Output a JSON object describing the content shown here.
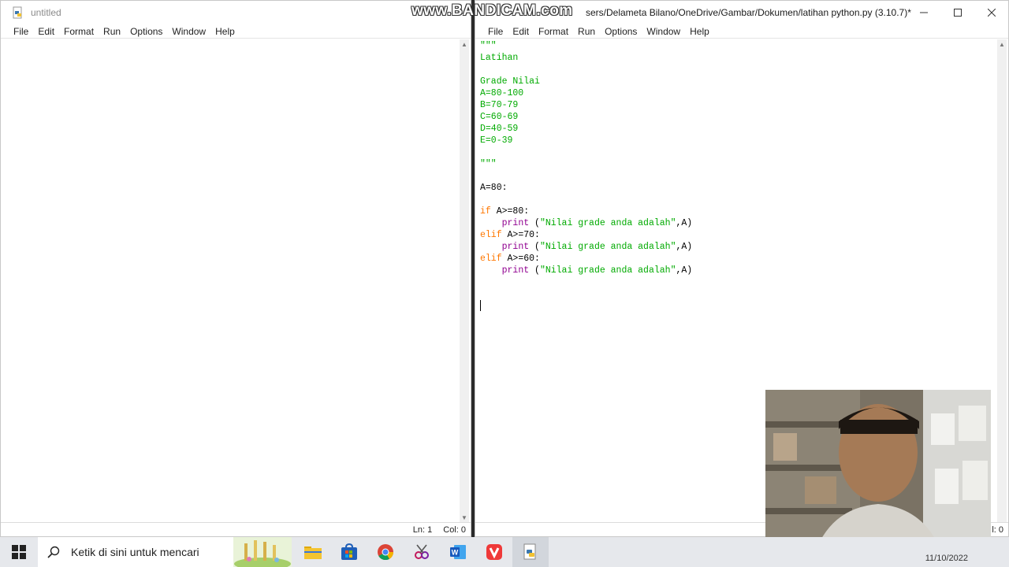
{
  "watermark": "www.BANDICAM.com",
  "left_window": {
    "title": "untitled",
    "menu": [
      "File",
      "Edit",
      "Format",
      "Run",
      "Options",
      "Window",
      "Help"
    ],
    "status_ln": "Ln: 1",
    "status_col": "Col: 0"
  },
  "right_window": {
    "title": "sers/Delameta Bilano/OneDrive/Gambar/Dokumen/latihan python.py (3.10.7)*",
    "menu": [
      "File",
      "Edit",
      "Format",
      "Run",
      "Options",
      "Window",
      "Help"
    ],
    "status_col": "l: 0",
    "code_lines": [
      [
        {
          "t": "\"\"\"",
          "c": "str"
        }
      ],
      [
        {
          "t": "Latihan",
          "c": "str"
        }
      ],
      [],
      [
        {
          "t": "Grade Nilai",
          "c": "str"
        }
      ],
      [
        {
          "t": "A=80-100",
          "c": "str"
        }
      ],
      [
        {
          "t": "B=70-79",
          "c": "str"
        }
      ],
      [
        {
          "t": "C=60-69",
          "c": "str"
        }
      ],
      [
        {
          "t": "D=40-59",
          "c": "str"
        }
      ],
      [
        {
          "t": "E=0-39",
          "c": "str"
        }
      ],
      [],
      [
        {
          "t": "\"\"\"",
          "c": "str"
        }
      ],
      [],
      [
        {
          "t": "A=80:",
          "c": "df"
        }
      ],
      [],
      [
        {
          "t": "if",
          "c": "kw"
        },
        {
          "t": " A>=80:",
          "c": "df"
        }
      ],
      [
        {
          "t": "    ",
          "c": "df"
        },
        {
          "t": "print",
          "c": "bi"
        },
        {
          "t": " (",
          "c": "df"
        },
        {
          "t": "\"Nilai grade anda adalah\"",
          "c": "str"
        },
        {
          "t": ",A)",
          "c": "df"
        }
      ],
      [
        {
          "t": "elif",
          "c": "kw"
        },
        {
          "t": " A>=70:",
          "c": "df"
        }
      ],
      [
        {
          "t": "    ",
          "c": "df"
        },
        {
          "t": "print",
          "c": "bi"
        },
        {
          "t": " (",
          "c": "df"
        },
        {
          "t": "\"Nilai grade anda adalah\"",
          "c": "str"
        },
        {
          "t": ",A)",
          "c": "df"
        }
      ],
      [
        {
          "t": "elif",
          "c": "kw"
        },
        {
          "t": " A>=60:",
          "c": "df"
        }
      ],
      [
        {
          "t": "    ",
          "c": "df"
        },
        {
          "t": "print",
          "c": "bi"
        },
        {
          "t": " (",
          "c": "df"
        },
        {
          "t": "\"Nilai grade anda adalah\"",
          "c": "str"
        },
        {
          "t": ",A)",
          "c": "df"
        }
      ],
      [],
      [],
      [
        {
          "t": "",
          "c": "cursor"
        }
      ]
    ]
  },
  "taskbar": {
    "search_placeholder": "Ketik di sini untuk mencari",
    "apps": [
      "file-explorer-icon",
      "microsoft-store-icon",
      "chrome-icon",
      "snipping-tool-icon",
      "word-icon",
      "vivaldi-icon",
      "python-idle-icon"
    ],
    "date": "11/10/2022"
  },
  "colors": {
    "string": "#00aa00",
    "keyword": "#ff7700",
    "builtin": "#900090"
  }
}
